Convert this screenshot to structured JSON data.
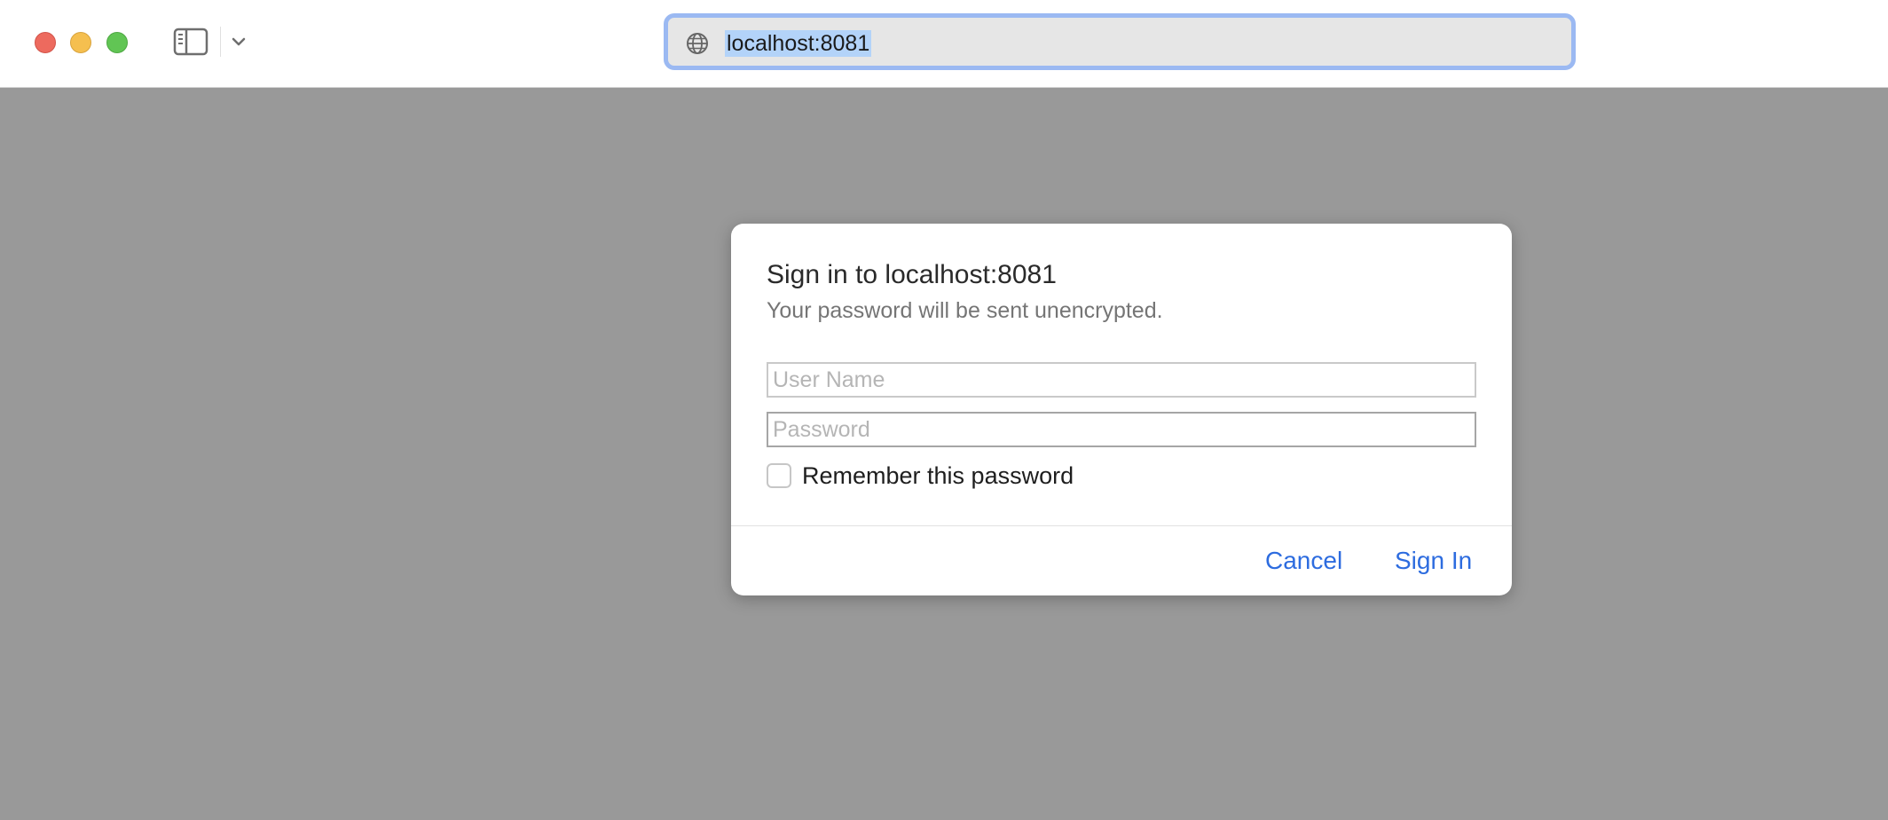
{
  "window": {
    "controls": {
      "close": "close-icon",
      "minimize": "minimize-icon",
      "zoom": "zoom-icon"
    },
    "toolbar": {
      "sidebar_icon": "sidebar-icon",
      "menu_icon": "chevron-down-icon"
    },
    "address_bar": {
      "icon": "globe-icon",
      "url": "localhost:8081"
    }
  },
  "dialog": {
    "title": "Sign in to localhost:8081",
    "subtitle": "Your password will be sent unencrypted.",
    "username": {
      "placeholder": "User Name",
      "value": ""
    },
    "password": {
      "placeholder": "Password",
      "value": ""
    },
    "remember": {
      "label": "Remember this password",
      "checked": false
    },
    "cancel_label": "Cancel",
    "signin_label": "Sign In"
  },
  "colors": {
    "backdrop": "#999999",
    "accent": "#2d6cdf",
    "focus_ring": "#9bb9f2",
    "selection": "#b3d3f9",
    "close": "#ed6a5e",
    "minimize": "#f5bf4f",
    "zoom": "#61c554"
  }
}
